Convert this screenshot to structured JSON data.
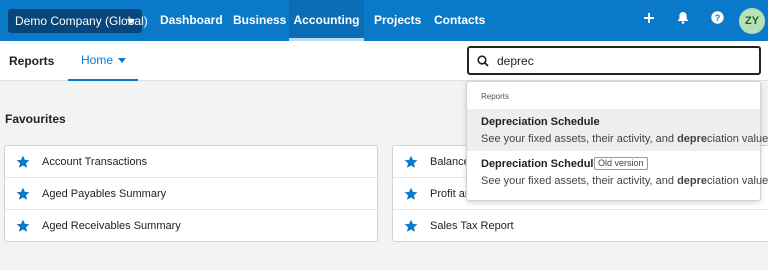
{
  "topnav": {
    "org_label": "Demo Company (Global)",
    "links": [
      "Dashboard",
      "Business",
      "Accounting",
      "Projects",
      "Contacts"
    ],
    "active": "Accounting",
    "add_icon": "plus-icon",
    "notifications_icon": "bell-icon",
    "help_icon": "help-icon",
    "avatar_initials": "ZY",
    "colors": {
      "nav_bg": "#0b79c9",
      "org_bg": "#07467a",
      "avatar_bg": "#b7e1b4"
    }
  },
  "subheader": {
    "title": "Reports",
    "tab_home": "Home"
  },
  "search": {
    "value": "deprec",
    "icon": "search-icon"
  },
  "favourites": {
    "title": "Favourites",
    "left": [
      "Account Transactions",
      "Aged Payables Summary",
      "Aged Receivables Summary"
    ],
    "right": [
      "Balance",
      "Profit an",
      "Sales Tax Report"
    ],
    "star_icon": "star-icon",
    "star_color": "#0b79c9"
  },
  "dropdown": {
    "section_label": "Reports",
    "results": [
      {
        "title": "Depreciation Schedule",
        "desc_prefix": "See your fixed assets, their activity, and ",
        "desc_match": "depre",
        "desc_suffix": "ciation values"
      },
      {
        "title": "Depreciation Schedule",
        "badge": "Old version",
        "desc_prefix": "See your fixed assets, their activity, and ",
        "desc_match": "depre",
        "desc_suffix": "ciation values"
      }
    ]
  }
}
